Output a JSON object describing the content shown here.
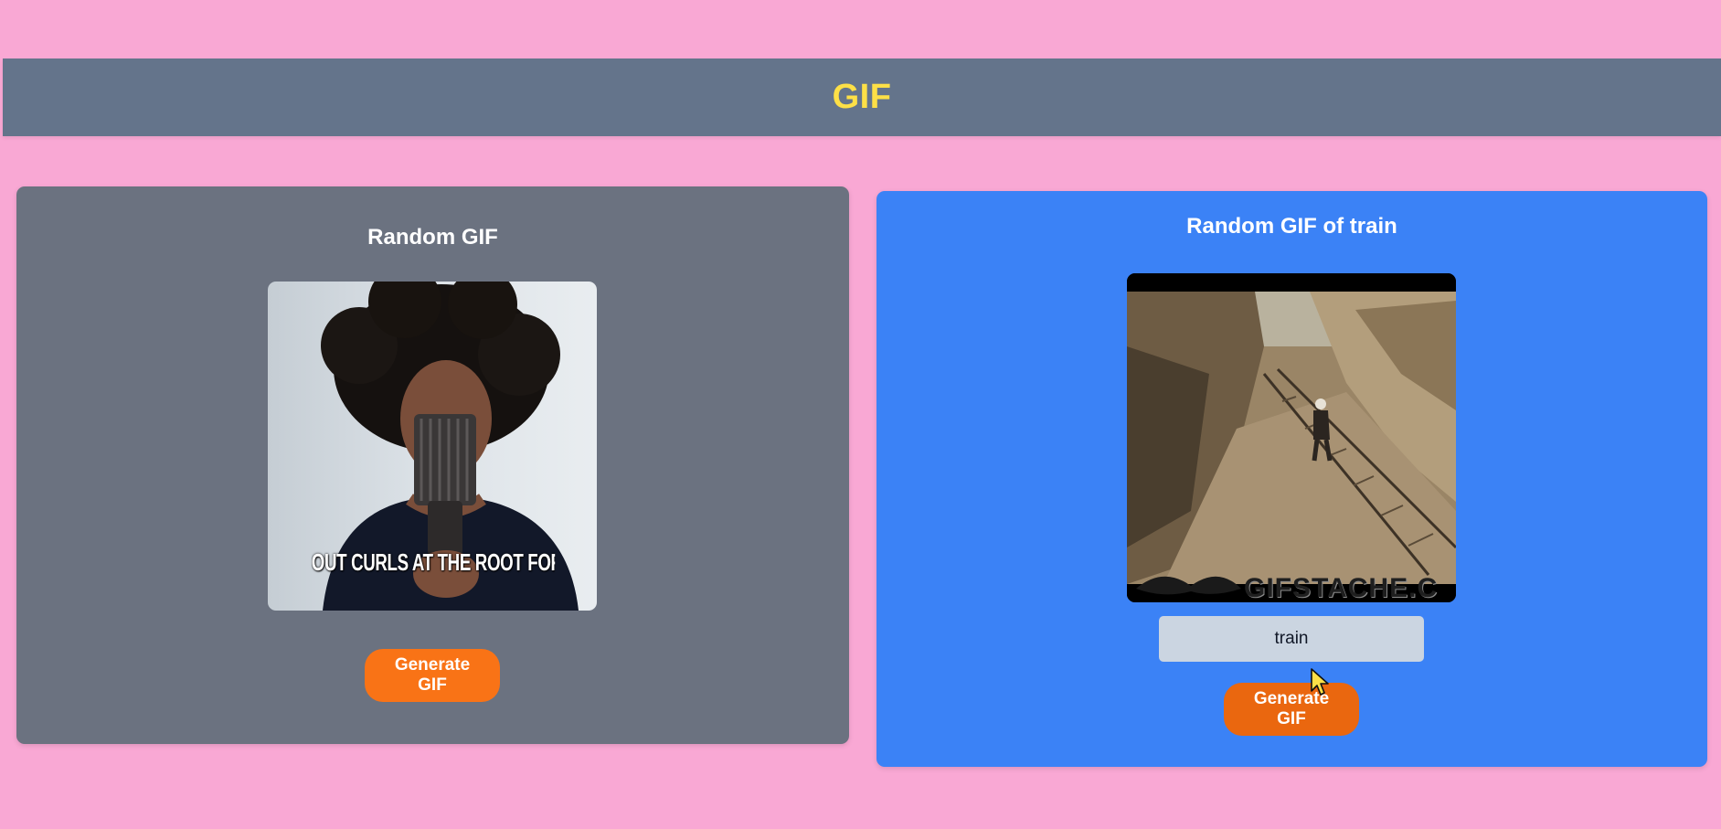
{
  "header": {
    "title": "GIF"
  },
  "random_card": {
    "title": "Random GIF",
    "gif_caption": "OUT CURLS AT THE ROOT FOR ADDED VO",
    "button_label": "Generate GIF"
  },
  "tag_card": {
    "title": "Random GIF of train",
    "gif_watermark": "GIFSTACHE.C",
    "input_value": "train",
    "button_label": "Generate GIF"
  },
  "colors": {
    "background": "#f9a8d4",
    "header": "#64748b",
    "title": "#fde047",
    "random_card": "#6b7280",
    "tag_card": "#3b82f6",
    "button": "#f97316",
    "input": "#cbd5e1"
  },
  "icons": {
    "cursor": "cursor-arrow-icon"
  }
}
